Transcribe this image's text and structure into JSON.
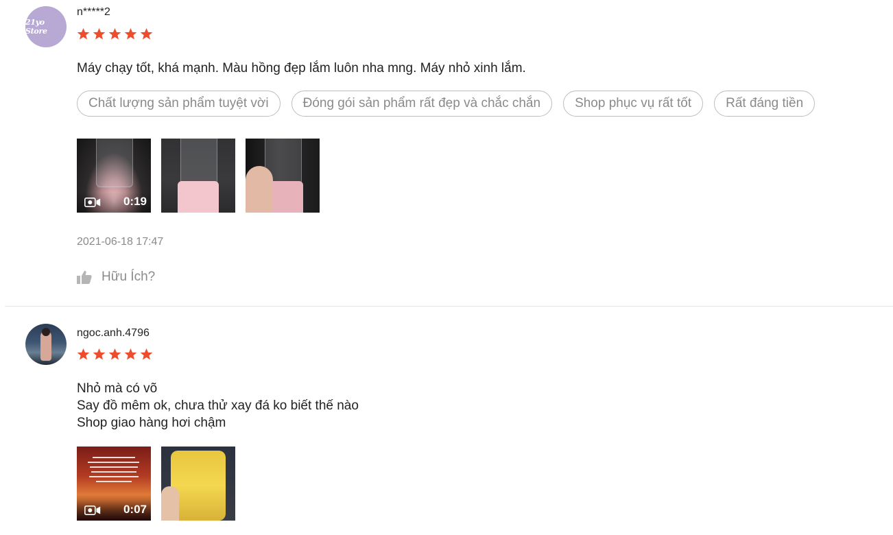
{
  "colors": {
    "star": "#ee4d2d",
    "muted": "#8a8a8a",
    "text": "#222222"
  },
  "reviews": [
    {
      "avatar_text": "21yo Store",
      "username": "n*****2",
      "rating": 5,
      "content_lines": [
        "Máy chạy tốt, khá mạnh. Màu hồng đẹp lắm luôn nha mng. Máy nhỏ xinh lắm."
      ],
      "tags": [
        "Chất lượng sản phẩm tuyệt vời",
        "Đóng gói sản phẩm rất đẹp và chắc chắn",
        "Shop phục vụ rất tốt",
        "Rất đáng tiền"
      ],
      "media": [
        {
          "type": "video",
          "duration": "0:19",
          "icon": "video-camera-icon"
        },
        {
          "type": "image"
        },
        {
          "type": "image"
        }
      ],
      "date": "2021-06-18 17:47",
      "helpful_label": "Hữu Ích?",
      "helpful_icon": "thumbs-up-icon"
    },
    {
      "username": "ngoc.anh.4796",
      "rating": 5,
      "content_lines": [
        "Nhỏ mà có võ",
        "Say đồ mêm ok, chưa thử xay đá ko biết thế nào",
        "Shop giao hàng hơi chậm"
      ],
      "media": [
        {
          "type": "video",
          "duration": "0:07",
          "icon": "video-camera-icon"
        },
        {
          "type": "image"
        }
      ]
    }
  ]
}
